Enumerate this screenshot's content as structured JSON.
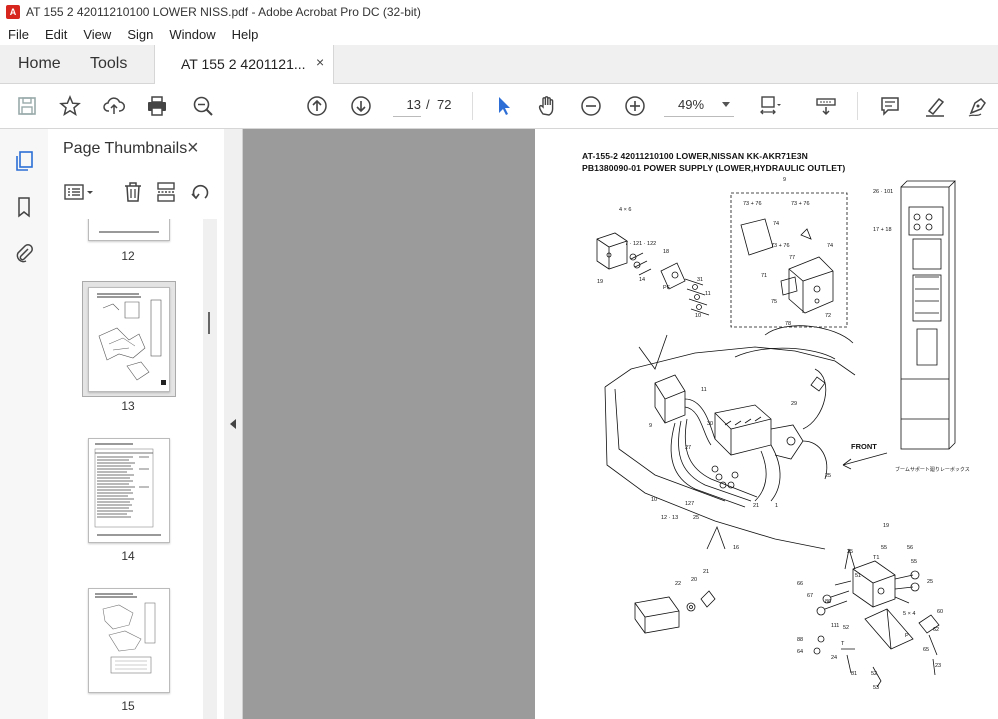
{
  "window": {
    "title": "AT 155 2 42011210100 LOWER NISS.pdf - Adobe Acrobat Pro DC (32-bit)"
  },
  "menu": [
    "File",
    "Edit",
    "View",
    "Sign",
    "Window",
    "Help"
  ],
  "tabs": {
    "home": "Home",
    "tools": "Tools",
    "doc": "AT 155 2 4201121...",
    "close": "×"
  },
  "toolbar": {
    "current_page": "13",
    "page_sep": "/",
    "total_pages": "72",
    "zoom": "49%"
  },
  "panel": {
    "title": "Page Thumbnails",
    "close": "×"
  },
  "thumbnails": [
    {
      "label": "12"
    },
    {
      "label": "13",
      "selected": true
    },
    {
      "label": "14"
    },
    {
      "label": "15"
    }
  ],
  "page": {
    "line1": "AT-155-2 42011210100 LOWER,NISSAN KK-AKR71E3N",
    "line2": "PB1380090-01 POWER SUPPLY (LOWER,HYDRAULIC OUTLET)",
    "front_label": "FRONT",
    "caption_jp": "ブームサポート廻りレーボックス"
  },
  "colors": {
    "accent": "#2c6ed5",
    "viewer_bg": "#9b9b9b",
    "tab_bg": "#f0f0f0"
  }
}
